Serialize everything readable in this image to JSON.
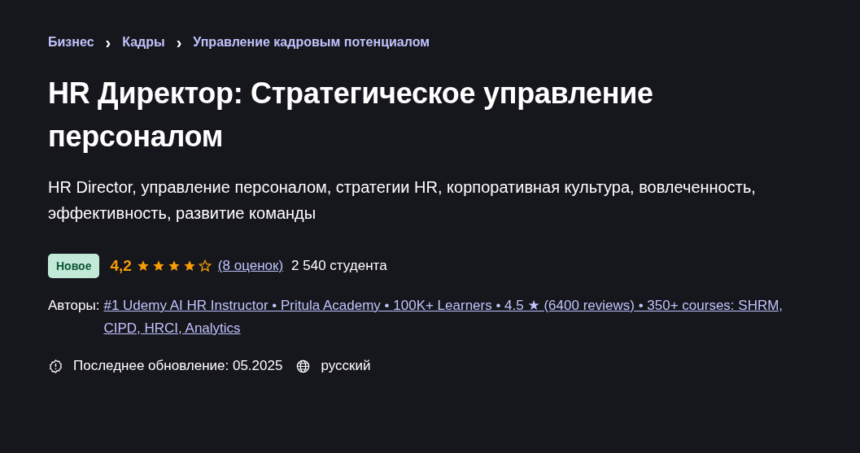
{
  "breadcrumbs": [
    "Бизнес",
    "Кадры",
    "Управление кадровым потенциалом"
  ],
  "breadcrumb_separator": "›",
  "title": "HR Директор: Стратегическое управление персоналом",
  "subtitle": "HR Director, управление персоналом, стратегии HR, корпоративная культура, вовлеченность, эффективность, развитие команды",
  "badge": "Новое",
  "rating": {
    "value": "4,2",
    "stars": 4,
    "count": "(8 оценок)",
    "students": "2 540 студента"
  },
  "authors": {
    "label": "Авторы:",
    "link": "#1 Udemy AI HR Instructor • Pritula Academy • 100K+ Learners • 4.5 ★ (6400 reviews) • 350+ courses: SHRM, CIPD, HRCI, Analytics"
  },
  "meta": [
    {
      "kind": "update",
      "text": "Последнее обновление: 05.2025"
    },
    {
      "kind": "language",
      "text": "русский"
    }
  ]
}
